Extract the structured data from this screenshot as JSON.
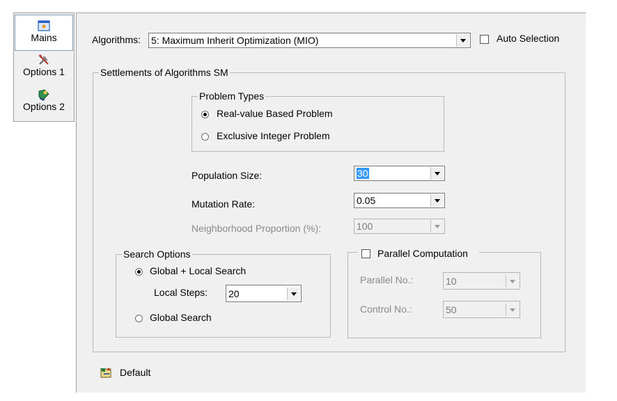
{
  "nav": {
    "items": [
      {
        "label": "Mains",
        "icon": "mains-icon",
        "selected": true
      },
      {
        "label": "Options 1",
        "icon": "tools-icon"
      },
      {
        "label": "Options 2",
        "icon": "options2-icon"
      }
    ]
  },
  "algorithms": {
    "label": "Algorithms:",
    "value": "5: Maximum Inherit Optimization (MIO)",
    "auto_selection_label": "Auto Selection",
    "auto_selection_checked": false
  },
  "settlements": {
    "title": "Settlements of Algorithms SM",
    "problem_types": {
      "title": "Problem Types",
      "options": [
        {
          "label": "Real-value Based Problem",
          "selected": true
        },
        {
          "label": "Exclusive Integer Problem",
          "selected": false
        }
      ]
    },
    "population_size": {
      "label": "Population Size:",
      "value": "30"
    },
    "mutation_rate": {
      "label": "Mutation Rate:",
      "value": "0.05"
    },
    "neighborhood": {
      "label": "Neighborhood Proportion (%):",
      "value": "100"
    }
  },
  "search_options": {
    "title": "Search Options",
    "global_local_label": "Global + Local Search",
    "local_steps_label": "Local Steps:",
    "local_steps_value": "20",
    "global_label": "Global Search",
    "selected": "global_local"
  },
  "parallel": {
    "title": "Parallel Computation",
    "checked": false,
    "parallel_no_label": "Parallel No.:",
    "parallel_no_value": "10",
    "control_no_label": "Control No.:",
    "control_no_value": "50"
  },
  "footer": {
    "default_label": "Default"
  }
}
